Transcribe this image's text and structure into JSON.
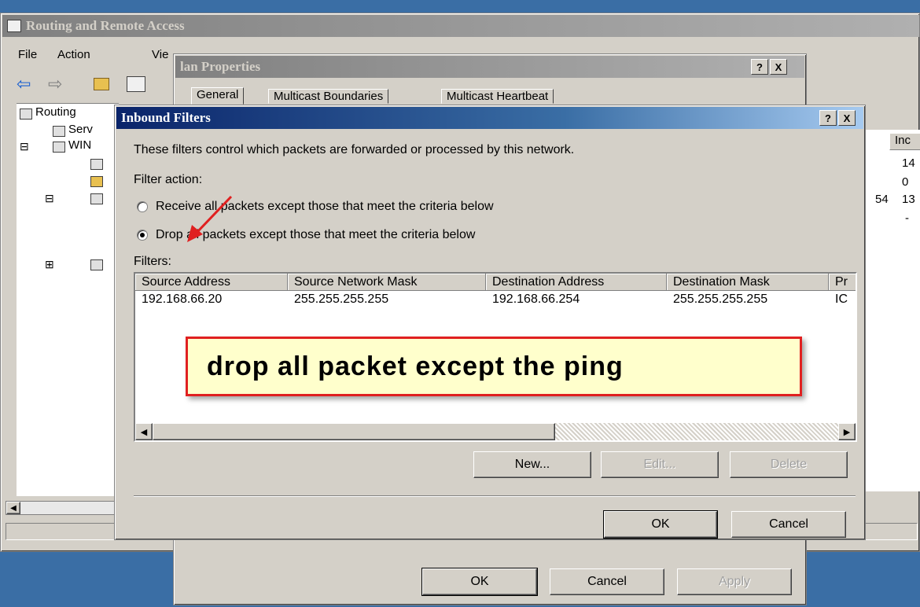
{
  "main_window": {
    "title": "Routing and Remote Access",
    "menu": [
      "File",
      "Action",
      "Vie"
    ],
    "tree": [
      "Routing",
      "Serv",
      "WIN"
    ],
    "right_header": "Inc",
    "right_values": [
      "14",
      "0",
      "13",
      "-"
    ],
    "right_partial": "54"
  },
  "properties_dialog": {
    "title": "lan Properties",
    "help_label": "?",
    "close_label": "X",
    "tabs": [
      "General",
      "Multicast Boundaries",
      "Multicast Heartbeat"
    ],
    "ok_label": "OK",
    "cancel_label": "Cancel",
    "apply_label": "Apply"
  },
  "inbound_filters": {
    "title": "Inbound Filters",
    "help_label": "?",
    "close_label": "X",
    "description": "These filters control which packets are forwarded or processed by this network.",
    "filter_action_label": "Filter action:",
    "option_receive": "Receive all packets except those that meet the criteria below",
    "option_drop": "Drop all packets except those that meet the criteria below",
    "selected_option": "drop",
    "filters_label": "Filters:",
    "columns": [
      "Source Address",
      "Source Network Mask",
      "Destination Address",
      "Destination Mask",
      "Pr"
    ],
    "rows": [
      [
        "192.168.66.20",
        "255.255.255.255",
        "192.168.66.254",
        "255.255.255.255",
        "IC"
      ]
    ],
    "new_label": "New...",
    "edit_label": "Edit...",
    "delete_label": "Delete",
    "ok_label": "OK",
    "cancel_label": "Cancel"
  },
  "annotation": {
    "text": "drop all packet except the ping",
    "border_color": "#e02020",
    "fill_color": "#ffffcc",
    "arrow_color": "#e02020"
  }
}
